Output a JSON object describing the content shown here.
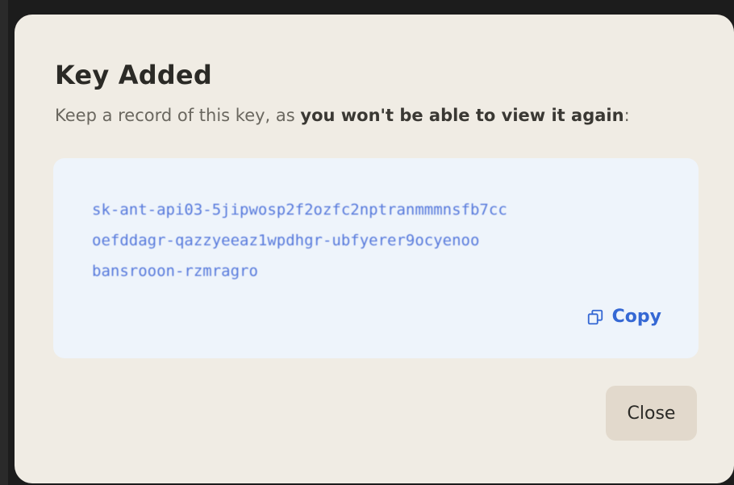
{
  "dialog": {
    "title": "Key Added",
    "subtitle_prefix": "Keep a record of this key, as ",
    "subtitle_bold": "you won't be able to view it again",
    "subtitle_suffix": ":",
    "key_lines": [
      "sk-ant-api03-5jipwosp2f2ozfc2nptranmmmnsfb7cc",
      "oefddagr-qazzyeeaz1wpdhgr-ubfyerer9ocyenoo",
      "bansrooon-rzmragro"
    ],
    "copy_label": "Copy",
    "close_label": "Close"
  },
  "colors": {
    "dialog_bg": "#f0ece4",
    "key_box_bg": "#eef4fb",
    "accent": "#3568d4",
    "close_button_bg": "#e2d9cc"
  },
  "icons": {
    "copy": "copy-icon"
  }
}
